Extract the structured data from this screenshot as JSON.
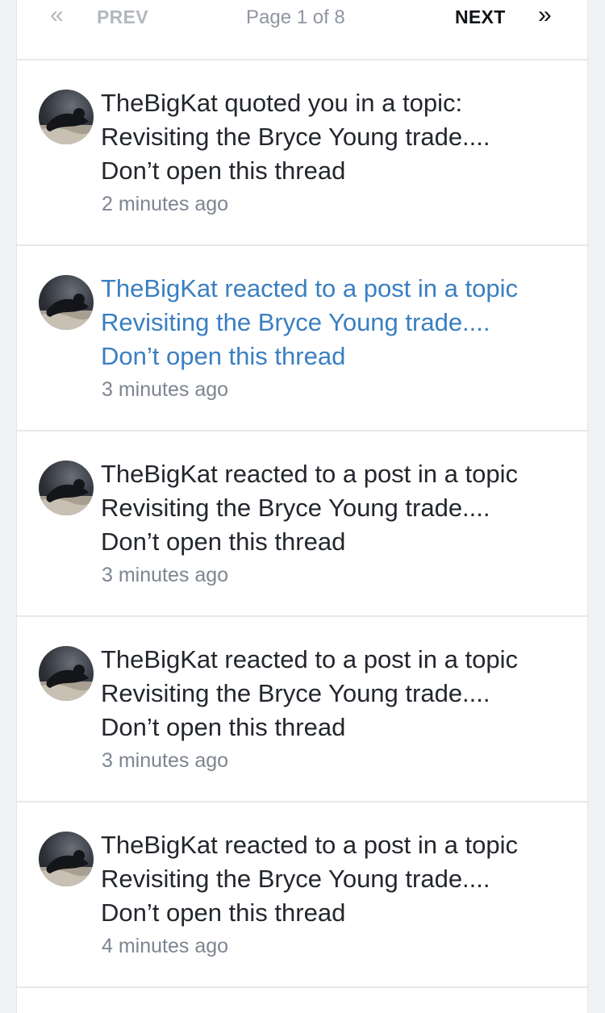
{
  "pagination": {
    "prev_label": "PREV",
    "page_info": "Page 1 of 8",
    "next_label": "NEXT",
    "first_icon": "double-chevron-left-icon",
    "last_icon": "double-chevron-right-icon"
  },
  "colors": {
    "link": "#3a7fc1",
    "text": "#23272d",
    "muted": "#7d8590",
    "disabled": "#b3b8bf",
    "background": "#f1f2f4"
  },
  "notifications": [
    {
      "line1": "TheBigKat quoted you in a topic:",
      "line2": "Revisiting the Bryce Young trade....",
      "line3": "Don’t open this thread",
      "time": "2 minutes ago",
      "highlighted": false
    },
    {
      "line1": "TheBigKat reacted to a post in a topic",
      "line2": "Revisiting the Bryce Young trade....",
      "line3": "Don’t open this thread",
      "time": "3 minutes ago",
      "highlighted": true
    },
    {
      "line1": "TheBigKat reacted to a post in a topic",
      "line2": "Revisiting the Bryce Young trade....",
      "line3": "Don’t open this thread",
      "time": "3 minutes ago",
      "highlighted": false
    },
    {
      "line1": "TheBigKat reacted to a post in a topic",
      "line2": "Revisiting the Bryce Young trade....",
      "line3": "Don’t open this thread",
      "time": "3 minutes ago",
      "highlighted": false
    },
    {
      "line1": "TheBigKat reacted to a post in a topic",
      "line2": "Revisiting the Bryce Young trade....",
      "line3": "Don’t open this thread",
      "time": "4 minutes ago",
      "highlighted": false
    }
  ]
}
